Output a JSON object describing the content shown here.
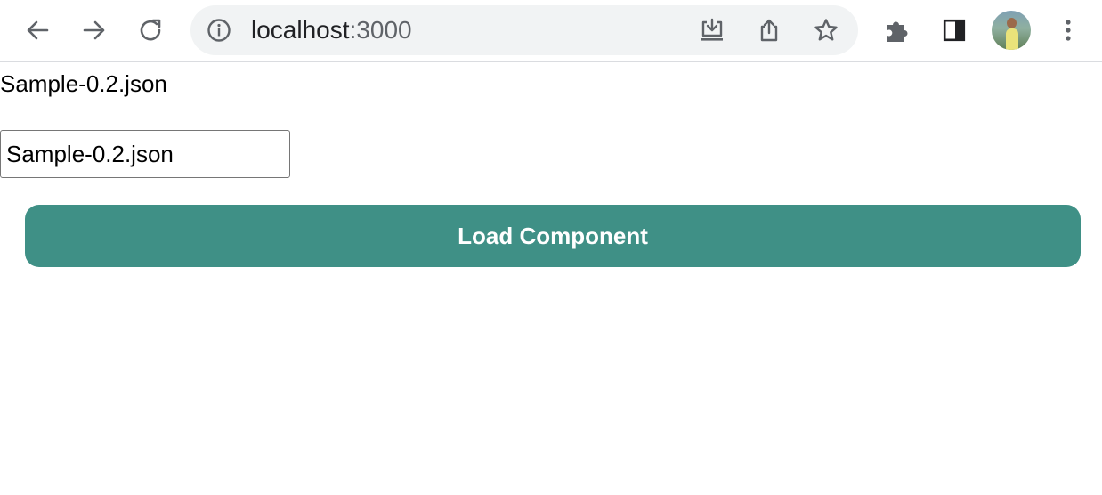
{
  "browser": {
    "url_host": "localhost",
    "url_port": ":3000",
    "icons": {
      "back": "arrow-left-icon",
      "forward": "arrow-right-icon",
      "reload": "reload-icon",
      "site_info": "info-icon",
      "install": "install-app-icon",
      "share": "share-icon",
      "bookmark": "star-icon",
      "extensions": "puzzle-icon",
      "side_panel": "side-panel-icon",
      "profile": "avatar",
      "menu": "kebab-menu-icon"
    }
  },
  "page": {
    "file_label": "Sample-0.2.json",
    "file_input_value": "Sample-0.2.json",
    "load_button_label": "Load Component"
  },
  "colors": {
    "button_bg": "#3f9086",
    "button_text": "#ffffff",
    "omnibox_bg": "#f1f3f4",
    "icon_gray": "#5f6368"
  }
}
